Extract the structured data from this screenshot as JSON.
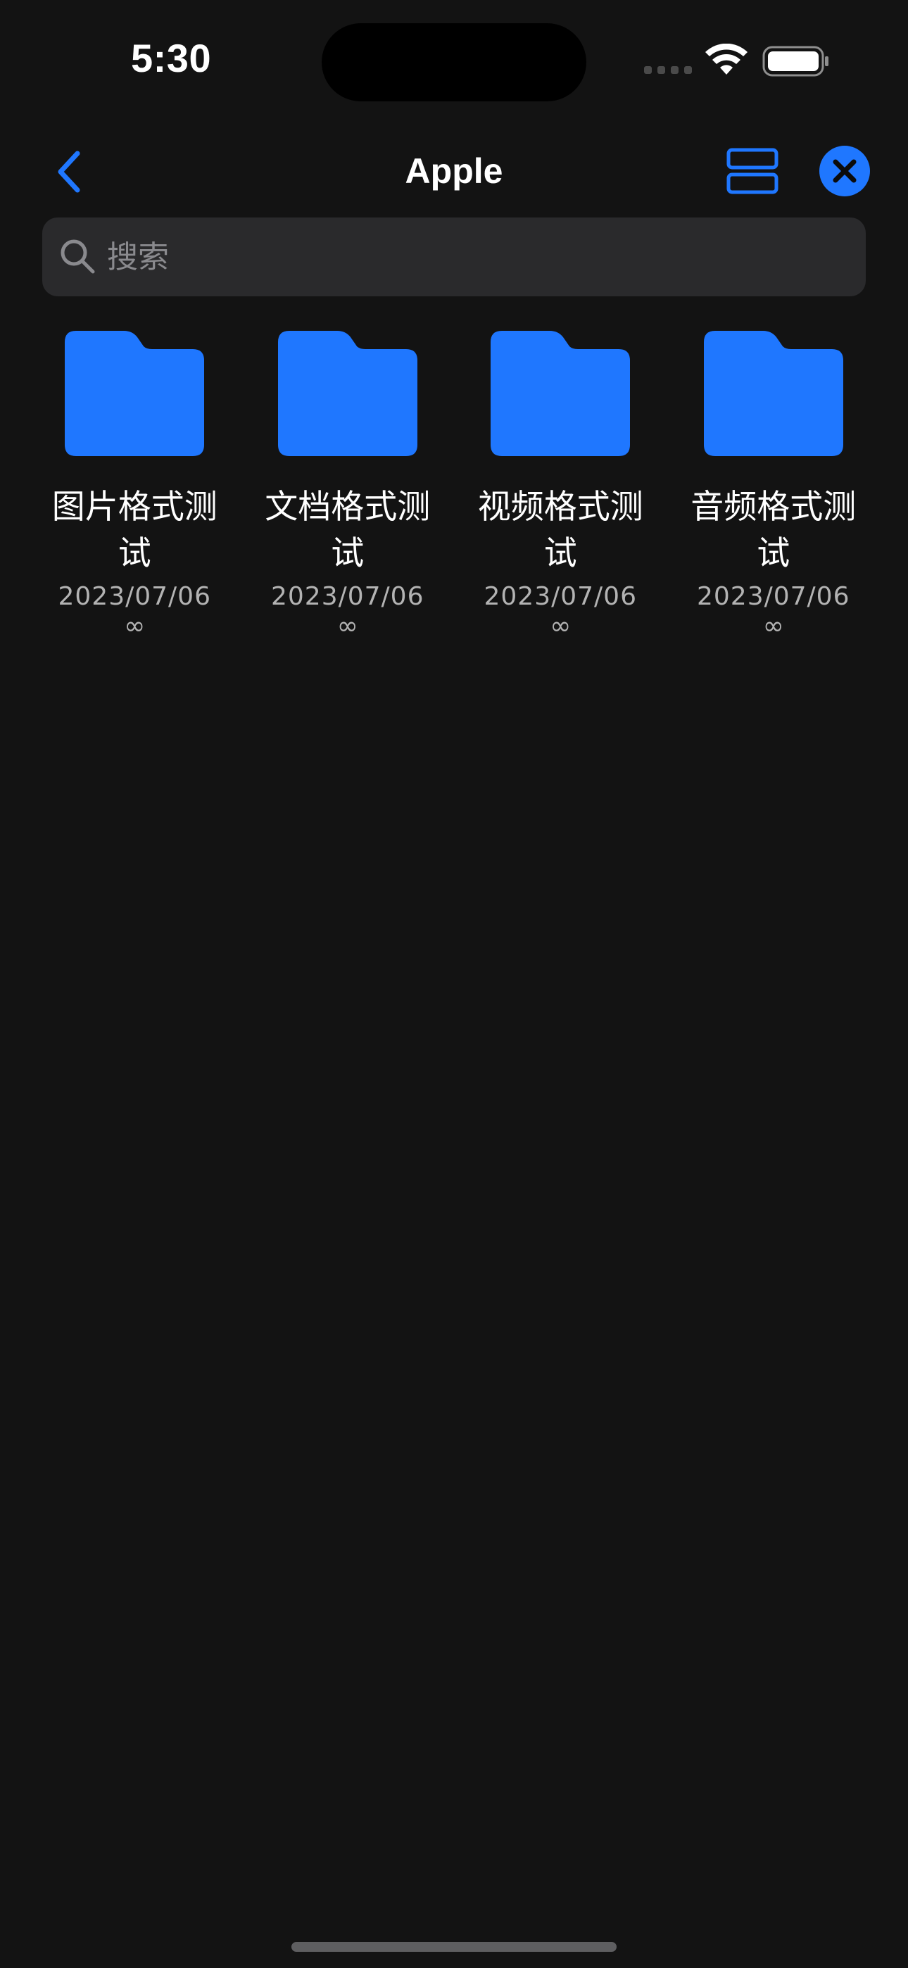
{
  "status_bar": {
    "time": "5:30"
  },
  "nav": {
    "title": "Apple",
    "back_icon": "chevron-left-icon",
    "view_toggle_icon": "list-view-icon",
    "close_icon": "close-icon"
  },
  "search": {
    "placeholder": "搜索",
    "value": ""
  },
  "folders": [
    {
      "name": "图片格式测试",
      "date": "2023/07/06",
      "count": "∞"
    },
    {
      "name": "文档格式测试",
      "date": "2023/07/06",
      "count": "∞"
    },
    {
      "name": "视频格式测试",
      "date": "2023/07/06",
      "count": "∞"
    },
    {
      "name": "音频格式测试",
      "date": "2023/07/06",
      "count": "∞"
    }
  ],
  "colors": {
    "accent": "#1f77ff",
    "background": "#131313",
    "search_background": "#2a2a2c",
    "secondary_text": "#b3b3b3"
  }
}
